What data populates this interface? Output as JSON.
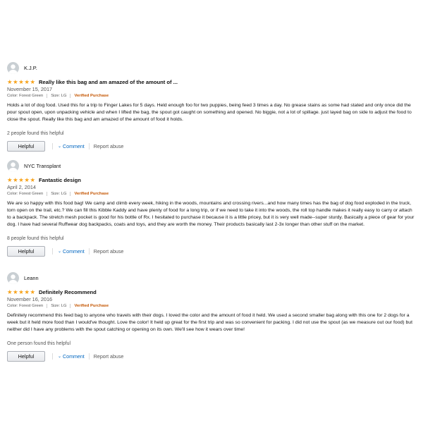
{
  "reviews": [
    {
      "reviewer": "K.J.P.",
      "rating": 5,
      "title": "Really like this bag and am amazed of the amount of ...",
      "date": "November 15, 2017",
      "color": "Color: Forest Green",
      "size": "Size: LG",
      "verified": "Verified Purchase",
      "body": "Holds a lot of dog food. Used this for a trip to Finger Lakes for 5 days. Held enough foo for two puppies, being feed 3 times a day. No grease stains as some had stated and only once did the pour spout open, upon unpacking vehicle and when I lifted the bag, the spout got caught on something and opened. No biggie, not a lot of spillage. just layed bag on side to adjust the food to close the spout. Really like this bag and am amazed of the amount of food it holds.",
      "helpful_count": "2 people found this helpful",
      "helpful_label": "Helpful",
      "comment_label": "Comment",
      "report_label": "Report abuse"
    },
    {
      "reviewer": "NYC Transplant",
      "rating": 5,
      "title": "Fantastic design",
      "date": "April 2, 2014",
      "color": "Color: Forest Green",
      "size": "Size: LG",
      "verified": "Verified Purchase",
      "body": "We are so happy with this food bag! We camp and climb every week, hiking in the woods, mountains and crossing rivers...and how many times has the bag of dog food exploded in the truck, torn open on the trail, etc.? We can fill this Kibble Kaddy and have plenty of food for a long trip, or if we need to take it into the woods, the roll top handle makes it really easy to carry or attach to a backpack. The stretch mesh pocket is good for his bottle of Rx. I hesitated to purchase it because it is a little pricey, but it is very well made--super sturdy. Basically a piece of gear for your dog. I have had several Ruffwear dog backpacks, coats and toys, and they are worth the money. Their products basically last 2-3x longer than other stuff on the market.",
      "helpful_count": "8 people found this helpful",
      "helpful_label": "Helpful",
      "comment_label": "Comment",
      "report_label": "Report abuse"
    },
    {
      "reviewer": "Leann",
      "rating": 5,
      "title": "Definitely Recommend",
      "date": "November 16, 2016",
      "color": "Color: Forest Green",
      "size": "Size: LG",
      "verified": "Verified Purchase",
      "body": "Definitely recommend this feed bag to anyone who travels with their dogs. I loved the color and the amount of food it held. We used a second smaller bag along with this one for 2 dogs for a week but it held more food than I would've thought. Love the color! It held up great for the first trip and was so convenient for packing. I did not use the spout (as we measure out our food) but neither did I have any problems with the spout catching or opening on its own. We'll see how it wears over time!",
      "helpful_count": "One person found this helpful",
      "helpful_label": "Helpful",
      "comment_label": "Comment",
      "report_label": "Report abuse"
    }
  ],
  "icons": {
    "star": "star-icon",
    "avatar": "user-avatar-icon",
    "chevron": "chevron-down-icon"
  },
  "colors": {
    "star": "#f7a31b",
    "verified": "#c45500",
    "link": "#0066c0"
  }
}
